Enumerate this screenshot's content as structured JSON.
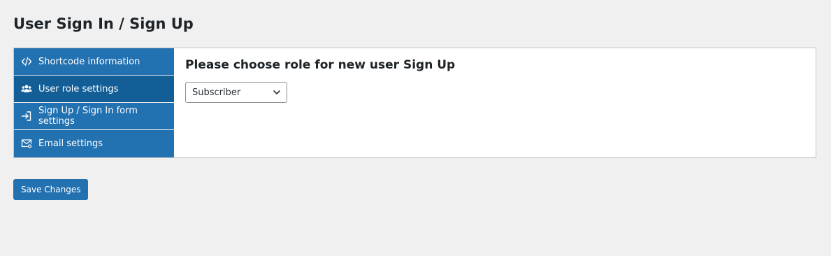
{
  "page": {
    "title": "User Sign In / Sign Up"
  },
  "sidebar": {
    "items": [
      {
        "label": "Shortcode information",
        "icon": "code-icon",
        "active": false
      },
      {
        "label": "User role settings",
        "icon": "users-icon",
        "active": true
      },
      {
        "label": "Sign Up / Sign In form settings",
        "icon": "sign-in-icon",
        "active": false
      },
      {
        "label": "Email settings",
        "icon": "email-settings-icon",
        "active": false
      }
    ]
  },
  "main": {
    "heading": "Please choose role for new user Sign Up",
    "role_select": {
      "selected": "Subscriber"
    }
  },
  "footer": {
    "save_label": "Save Changes"
  },
  "colors": {
    "background": "#f0f0f1",
    "accent": "#2271b1",
    "accent_active": "#135e96",
    "panel": "#ffffff",
    "text": "#1d2327"
  }
}
